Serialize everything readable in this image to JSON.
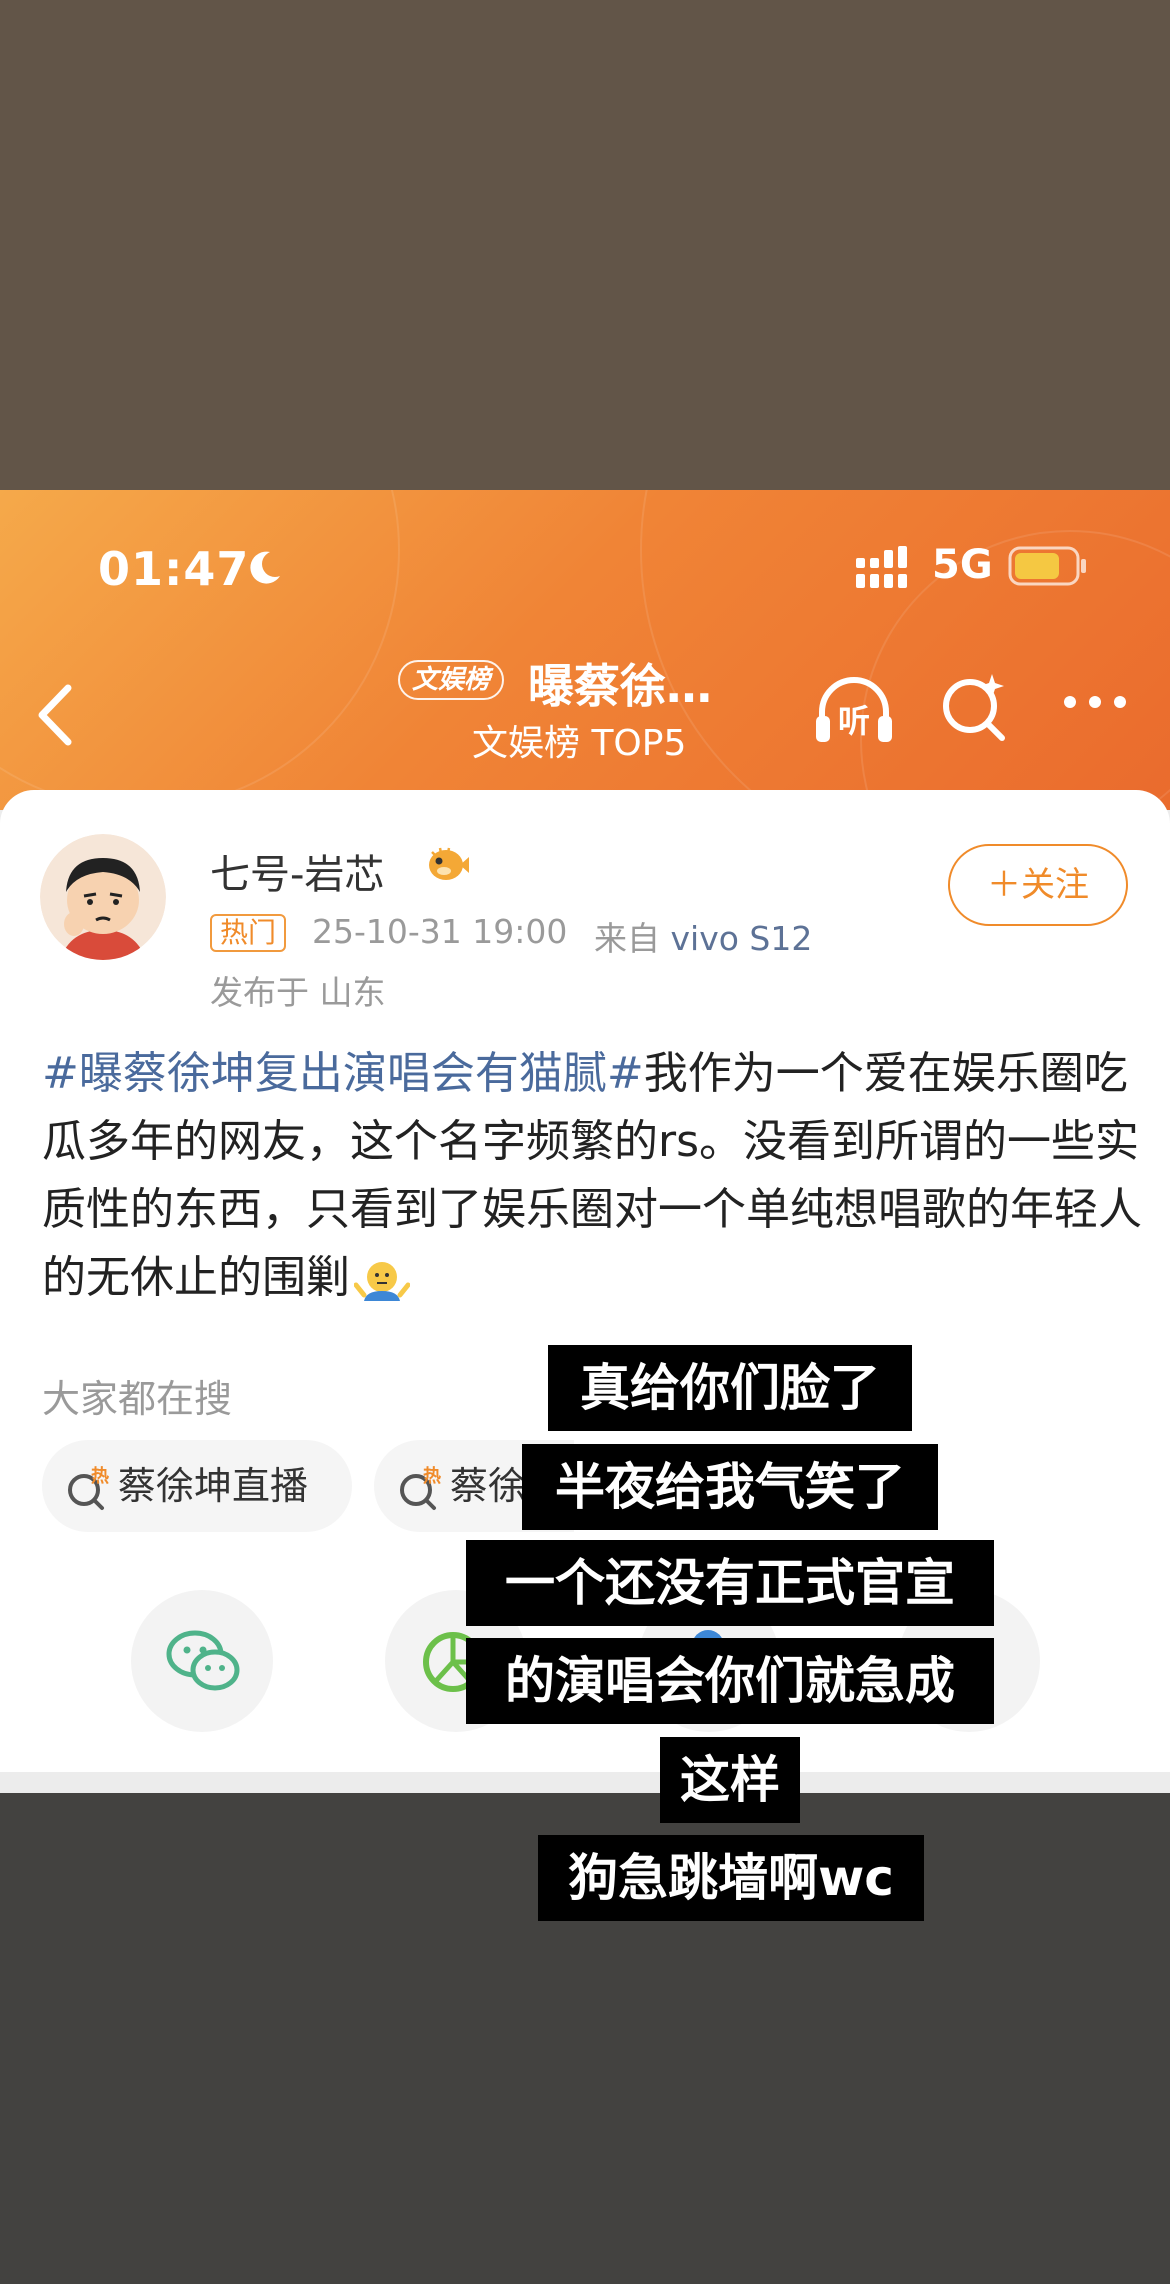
{
  "status_bar": {
    "time": "01:47",
    "network": "5G",
    "moon_icon": "moon-icon",
    "signal_icon": "signal-icon",
    "battery_icon": "battery-icon",
    "battery_color": "#f5c842"
  },
  "nav": {
    "badge": "文娱榜",
    "title": "曝蔡徐…",
    "subtitle": "文娱榜 TOP5",
    "listen_label": "听",
    "icons": [
      "back-icon",
      "headphones-icon",
      "search-spark-icon",
      "more-icon"
    ]
  },
  "post": {
    "username": "七号-岩芯",
    "hot_tag": "热门",
    "time": "25-10-31 19:00",
    "from_prefix": "来自",
    "device": "vivo S12",
    "location": "发布于 山东",
    "follow_label": "＋关注",
    "hashtag": "#曝蔡徐坤复出演唱会有猫腻#",
    "body": "我作为一个爱在娱乐圈吃瓜多年的网友，这个名字频繁的rs。没看到所谓的一些实质性的东西，只看到了娱乐圈对一个单纯想唱歌的年轻人的无休止的围剿",
    "emoji": "shrug-emoji"
  },
  "search": {
    "title": "大家都在搜",
    "hot_mark": "热",
    "pills": [
      "蔡徐坤直播",
      "蔡徐"
    ]
  },
  "share": {
    "icons": [
      "wechat-icon",
      "moments-icon",
      "share-icon-3",
      "share-icon-4"
    ]
  },
  "overlay_text": [
    "真给你们脸了",
    "半夜给我气笑了",
    "一个还没有正式官宣",
    "的演唱会你们就急成",
    "这样",
    "狗急跳墙啊wc"
  ],
  "colors": {
    "header_orange": "#f08436",
    "accent_orange": "#f08b2a",
    "hashtag_blue": "#4a6a9c",
    "top_bg": "#625548",
    "bottom_bg": "#434240"
  }
}
